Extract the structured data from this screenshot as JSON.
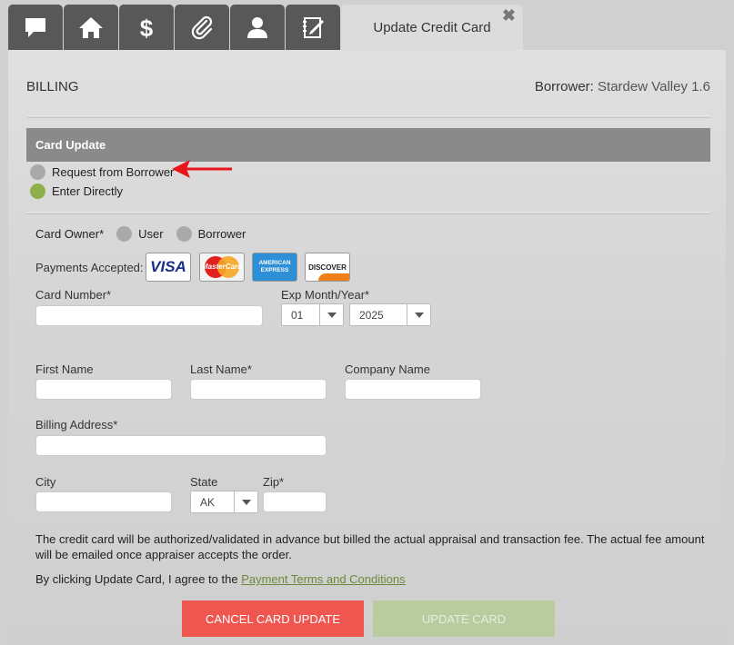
{
  "tabs": [
    {
      "icon": "comment-icon"
    },
    {
      "icon": "home-icon"
    },
    {
      "icon": "dollar-icon"
    },
    {
      "icon": "paperclip-icon"
    },
    {
      "icon": "user-icon"
    },
    {
      "icon": "notebook-icon"
    }
  ],
  "active_tab": {
    "title": "Update Credit Card",
    "close_glyph": "✖"
  },
  "header": {
    "section": "BILLING",
    "borrower_label": "Borrower:",
    "borrower_name": "Stardew Valley 1.6"
  },
  "card_update": {
    "title": "Card Update",
    "options": [
      {
        "label": "Request from Borrower",
        "selected": false
      },
      {
        "label": "Enter Directly",
        "selected": true
      }
    ]
  },
  "card_owner": {
    "label": "Card Owner*",
    "options": [
      "User",
      "Borrower"
    ]
  },
  "payments": {
    "label": "Payments Accepted:",
    "logos": [
      {
        "name": "visa",
        "text": "VISA"
      },
      {
        "name": "mastercard",
        "text": "MasterCard"
      },
      {
        "name": "amex",
        "text": "AMERICAN EXPRESS"
      },
      {
        "name": "discover",
        "text": "DISCOVER"
      }
    ]
  },
  "fields": {
    "card_number": {
      "label": "Card Number*",
      "value": ""
    },
    "exp": {
      "label": "Exp Month/Year*",
      "month": "01",
      "year": "2025"
    },
    "first_name": {
      "label": "First Name",
      "value": ""
    },
    "last_name": {
      "label": "Last Name*",
      "value": ""
    },
    "company": {
      "label": "Company Name",
      "value": ""
    },
    "address": {
      "label": "Billing Address*",
      "value": ""
    },
    "city": {
      "label": "City",
      "value": ""
    },
    "state": {
      "label": "State",
      "value": "AK"
    },
    "zip": {
      "label": "Zip*",
      "value": ""
    }
  },
  "notice": "The credit card will be authorized/validated in advance but billed the actual appraisal and transaction fee. The actual fee amount will be emailed once appraiser accepts the order.",
  "terms": {
    "prefix": "By clicking Update Card, I agree to the",
    "link": "Payment Terms and Conditions"
  },
  "buttons": {
    "cancel": "CANCEL CARD UPDATE",
    "update": "UPDATE CARD"
  },
  "colors": {
    "selected_dot": "#8db04a",
    "cancel": "#ef5650",
    "update_disabled": "#b9cca0",
    "annotation_arrow": "#e8161b"
  }
}
